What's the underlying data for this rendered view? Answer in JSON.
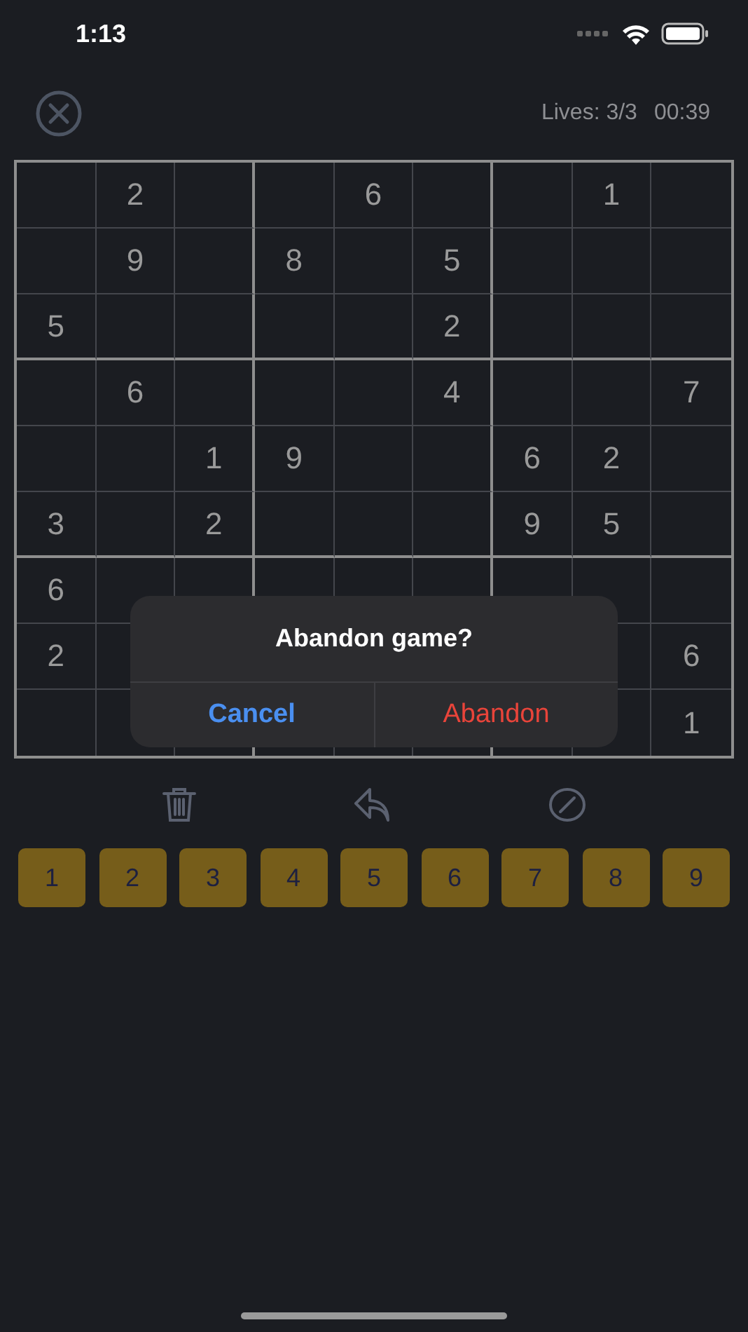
{
  "status_bar": {
    "time": "1:13"
  },
  "header": {
    "lives": "Lives: 3/3",
    "timer": "00:39"
  },
  "grid": {
    "rows": [
      [
        null,
        "2",
        null,
        null,
        "6",
        null,
        null,
        "1",
        null
      ],
      [
        null,
        "9",
        null,
        "8",
        null,
        "5",
        null,
        null,
        null
      ],
      [
        "5",
        null,
        null,
        null,
        null,
        "2",
        null,
        null,
        null
      ],
      [
        null,
        "6",
        null,
        null,
        null,
        "4",
        null,
        null,
        "7"
      ],
      [
        null,
        null,
        "1",
        "9",
        null,
        null,
        "6",
        "2",
        null
      ],
      [
        "3",
        null,
        "2",
        null,
        null,
        null,
        "9",
        "5",
        null
      ],
      [
        "6",
        null,
        null,
        null,
        null,
        null,
        null,
        null,
        null
      ],
      [
        "2",
        null,
        null,
        null,
        null,
        null,
        null,
        null,
        "6"
      ],
      [
        null,
        null,
        null,
        null,
        null,
        null,
        null,
        null,
        "1"
      ]
    ]
  },
  "dialog": {
    "title": "Abandon game?",
    "buttons": [
      {
        "label": "Cancel",
        "kind": "cancel"
      },
      {
        "label": "Abandon",
        "kind": "destructive"
      }
    ]
  },
  "number_pad": [
    "1",
    "2",
    "3",
    "4",
    "5",
    "6",
    "7",
    "8",
    "9"
  ]
}
